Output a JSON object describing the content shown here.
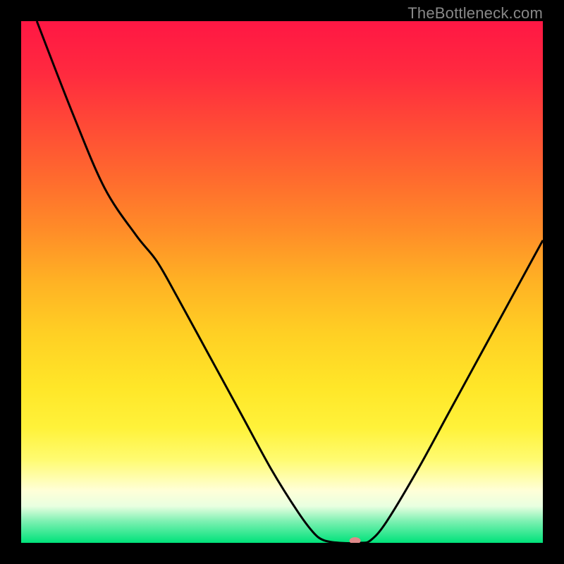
{
  "watermark": "TheBottleneck.com",
  "chart_data": {
    "type": "line",
    "title": "",
    "xlabel": "",
    "ylabel": "",
    "xlim": [
      0,
      100
    ],
    "ylim": [
      0,
      100
    ],
    "background_gradient_stops": [
      {
        "offset": 0.0,
        "color": "#ff1744"
      },
      {
        "offset": 0.1,
        "color": "#ff2a3f"
      },
      {
        "offset": 0.2,
        "color": "#ff4a36"
      },
      {
        "offset": 0.3,
        "color": "#ff6a2e"
      },
      {
        "offset": 0.4,
        "color": "#ff8c28"
      },
      {
        "offset": 0.5,
        "color": "#ffb224"
      },
      {
        "offset": 0.6,
        "color": "#ffd024"
      },
      {
        "offset": 0.7,
        "color": "#ffe628"
      },
      {
        "offset": 0.78,
        "color": "#fff23a"
      },
      {
        "offset": 0.84,
        "color": "#fffb70"
      },
      {
        "offset": 0.9,
        "color": "#ffffd8"
      },
      {
        "offset": 0.93,
        "color": "#e8ffe0"
      },
      {
        "offset": 0.96,
        "color": "#78f0b0"
      },
      {
        "offset": 1.0,
        "color": "#00e27a"
      }
    ],
    "series": [
      {
        "name": "bottleneck-curve",
        "color": "#000000",
        "points": [
          {
            "x": 3,
            "y": 100
          },
          {
            "x": 10,
            "y": 82
          },
          {
            "x": 16,
            "y": 68
          },
          {
            "x": 22,
            "y": 59
          },
          {
            "x": 26,
            "y": 54
          },
          {
            "x": 30,
            "y": 47
          },
          {
            "x": 36,
            "y": 36
          },
          {
            "x": 42,
            "y": 25
          },
          {
            "x": 48,
            "y": 14
          },
          {
            "x": 53,
            "y": 6
          },
          {
            "x": 56,
            "y": 2
          },
          {
            "x": 58,
            "y": 0.5
          },
          {
            "x": 61,
            "y": 0
          },
          {
            "x": 65,
            "y": 0
          },
          {
            "x": 67,
            "y": 0.5
          },
          {
            "x": 70,
            "y": 4
          },
          {
            "x": 76,
            "y": 14
          },
          {
            "x": 82,
            "y": 25
          },
          {
            "x": 88,
            "y": 36
          },
          {
            "x": 94,
            "y": 47
          },
          {
            "x": 100,
            "y": 58
          }
        ]
      }
    ],
    "marker": {
      "name": "optimal-point",
      "x": 64,
      "y": 0,
      "rx": 8,
      "ry": 5,
      "color": "#e08a8a"
    }
  }
}
